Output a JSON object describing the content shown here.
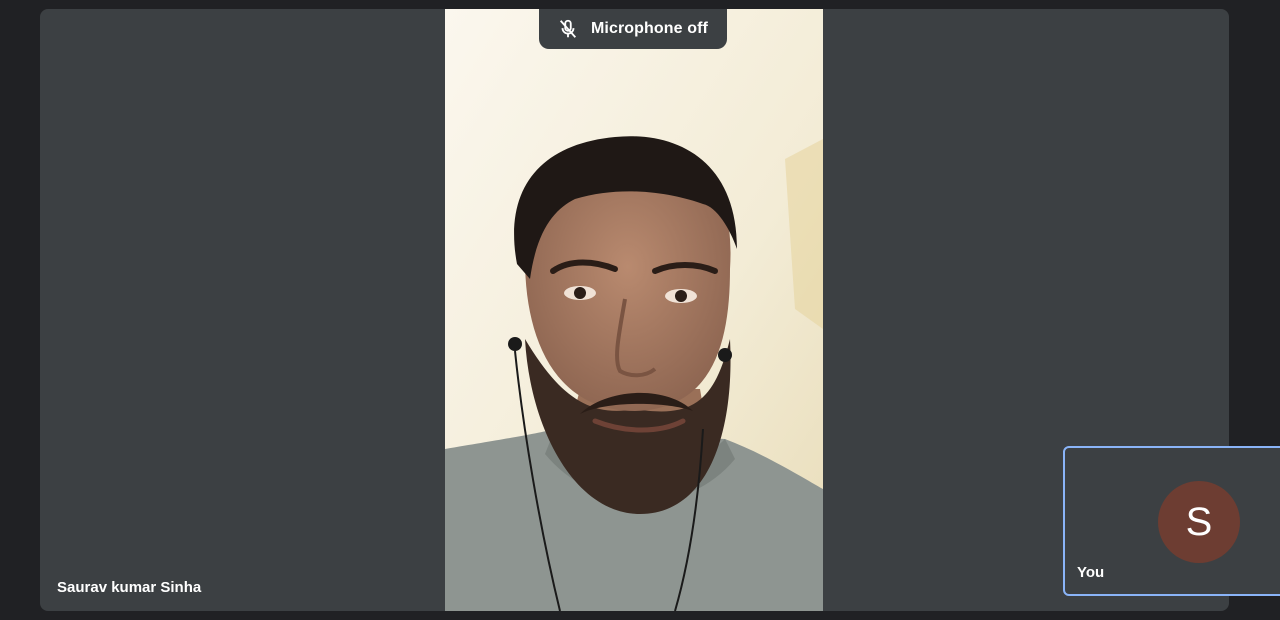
{
  "meeting": {
    "notification": {
      "icon": "microphone-off-icon",
      "text": "Microphone off"
    },
    "main_participant": {
      "name": "Saurav kumar Sinha"
    },
    "self_view": {
      "avatar_initial": "S",
      "avatar_color": "#6d3d32",
      "label": "You"
    }
  },
  "colors": {
    "app_background": "#202124",
    "tile_background": "#3c4043",
    "self_view_border": "#8ab4f8"
  }
}
